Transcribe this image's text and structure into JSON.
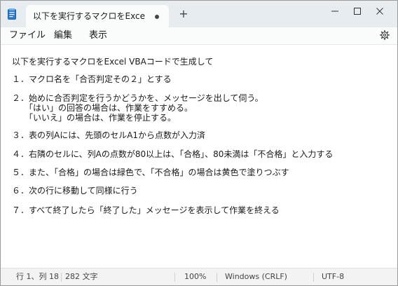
{
  "window": {
    "tab_title": "以下を実行するマクロをExcel VBA",
    "new_tab": "+"
  },
  "menu": {
    "file": "ファイル",
    "edit": "編集",
    "view": "表示"
  },
  "editor": {
    "lines": [
      "以下を実行するマクロをExcel VBAコードで生成して",
      "１．マクロ名を「合否判定その２」とする",
      "２．始めに合否判定を行うかどうかを、メッセージを出して伺う。",
      "　　「はい」の回答の場合は、作業をすすめる。",
      "　　「いいえ」の場合は、作業を停止する。",
      "３．表の列Aには、先頭のセルA1から点数が入力済",
      "４．右隣のセルに、列Aの点数が80以上は、「合格」、80未満は「不合格」と入力する",
      "５．また、「合格」の場合は緑色で、「不合格」の場合は黄色で塗りつぶす",
      "６．次の行に移動して同様に行う",
      "７．すべて終了したら「終了した」メッセージを表示して作業を終える"
    ]
  },
  "status": {
    "position": "行 1、列 18",
    "chars": "282 文字",
    "zoom": "100%",
    "line_ending": "Windows (CRLF)",
    "encoding": "UTF-8"
  },
  "colors": {
    "titlebar": "#e6ecf0",
    "editor_bg": "#ffffff",
    "text": "#1a1a1a"
  }
}
